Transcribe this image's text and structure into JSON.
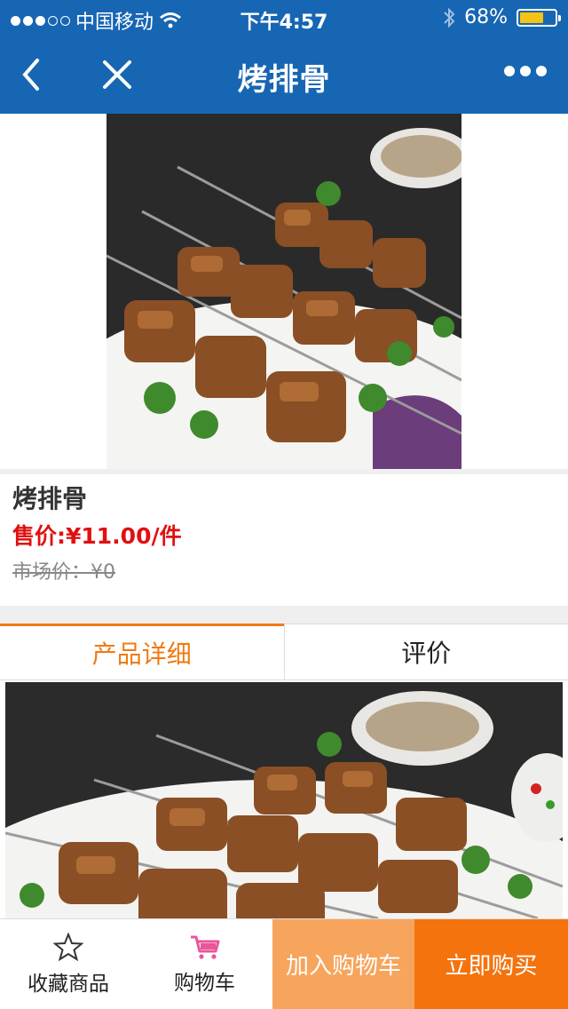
{
  "status": {
    "carrier": "中国移动",
    "time": "下午4:57",
    "battery": "68%",
    "battery_level": 0.68
  },
  "nav": {
    "title": "烤排骨"
  },
  "product": {
    "name": "烤排骨",
    "price": "售价:¥11.00/件",
    "market_price": "市场价：¥0"
  },
  "tabs": [
    {
      "label": "产品详细"
    },
    {
      "label": "评价"
    }
  ],
  "bottom": {
    "favorite": "收藏商品",
    "cart": "购物车",
    "add_to_cart": "加入购物车",
    "buy_now": "立即购买"
  },
  "colors": {
    "nav_blue": "#1766b3",
    "accent_orange": "#f07a13",
    "price_red": "#e01010",
    "cart_pink": "#e8579a"
  }
}
